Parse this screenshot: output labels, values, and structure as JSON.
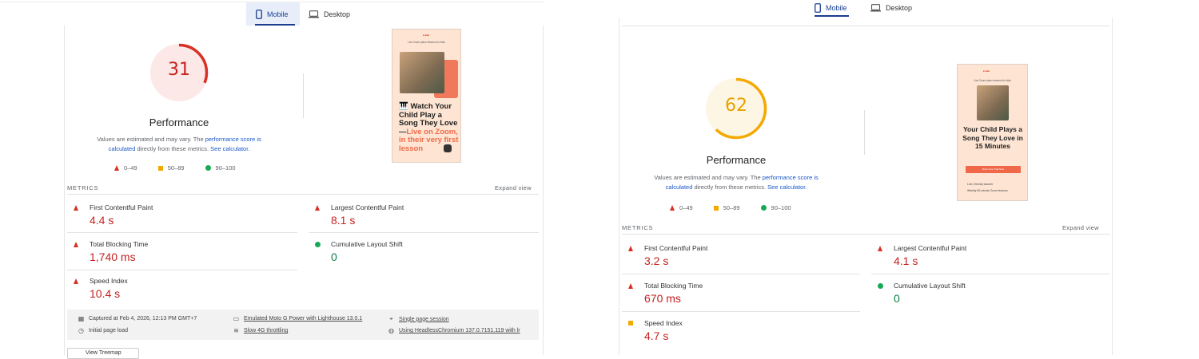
{
  "left": {
    "tabs": {
      "mobile": "Mobile",
      "desktop": "Desktop"
    },
    "score": "31",
    "score_value": 31,
    "score_color": "#d93025",
    "performance_label": "Performance",
    "note": {
      "part1": "Values are estimated and may vary. The ",
      "link1": "performance score is",
      "link1b": "calculated",
      "part2": " directly from these metrics. ",
      "link2": "See calculator."
    },
    "legend": {
      "fail": "0–49",
      "average": "50–89",
      "pass": "90–100"
    },
    "metrics_title": "METRICS",
    "expand": "Expand view",
    "metrics": [
      {
        "name": "First Contentful Paint",
        "value": "4.4 s",
        "status": "fail"
      },
      {
        "name": "Largest Contentful Paint",
        "value": "8.1 s",
        "status": "fail"
      },
      {
        "name": "Total Blocking Time",
        "value": "1,740 ms",
        "status": "fail"
      },
      {
        "name": "Cumulative Layout Shift",
        "value": "0",
        "status": "pass"
      },
      {
        "name": "Speed Index",
        "value": "10.4 s",
        "status": "fail"
      }
    ],
    "info": {
      "captured": "Captured at Feb 4, 2026, 12:13 PM GMT+7",
      "device": "Emulated Moto G Power with Lighthouse 13.0.1",
      "session": "Single page session",
      "load": "Initial page load",
      "throttling": "Slow 4G throttling",
      "browser": "Using HeadlessChromium 137.0.7151.119 with lr"
    },
    "thumbnail": {
      "subtitle": "Live Zoom piano lessons for kids",
      "headline_a": "🎹 Watch Your Child Play a Song They Love—",
      "headline_b": "Live on Zoom, in their very first lesson"
    },
    "treemap_label": "View Treemap"
  },
  "right": {
    "tabs": {
      "mobile": "Mobile",
      "desktop": "Desktop"
    },
    "score": "62",
    "score_value": 62,
    "score_color": "#f2a900",
    "performance_label": "Performance",
    "note": {
      "part1": "Values are estimated and may vary. The ",
      "link1": "performance score is",
      "link1b": "calculated",
      "part2": " directly from these metrics. ",
      "link2": "See calculator."
    },
    "legend": {
      "fail": "0–49",
      "average": "50–89",
      "pass": "90–100"
    },
    "metrics_title": "METRICS",
    "expand": "Expand view",
    "metrics": [
      {
        "name": "First Contentful Paint",
        "value": "3.2 s",
        "status": "fail"
      },
      {
        "name": "Largest Contentful Paint",
        "value": "4.1 s",
        "status": "fail"
      },
      {
        "name": "Total Blocking Time",
        "value": "670 ms",
        "status": "fail"
      },
      {
        "name": "Cumulative Layout Shift",
        "value": "0",
        "status": "pass"
      },
      {
        "name": "Speed Index",
        "value": "4.7 s",
        "status": "average"
      }
    ],
    "thumbnail": {
      "subtitle": "Live Zoom piano lessons for kids",
      "headline": "Your Child Plays a Song They Love in 15 Minutes",
      "cta": "Book Free Trial Now",
      "bullet1": "Live, friendly teacher",
      "bullet2": "Weekly 60-minute Zoom lessons"
    }
  },
  "colors": {
    "fail": "#d93025",
    "average": "#f2a900",
    "pass": "#18a957",
    "link": "#1a57c9",
    "accent": "#1a3d8f"
  }
}
